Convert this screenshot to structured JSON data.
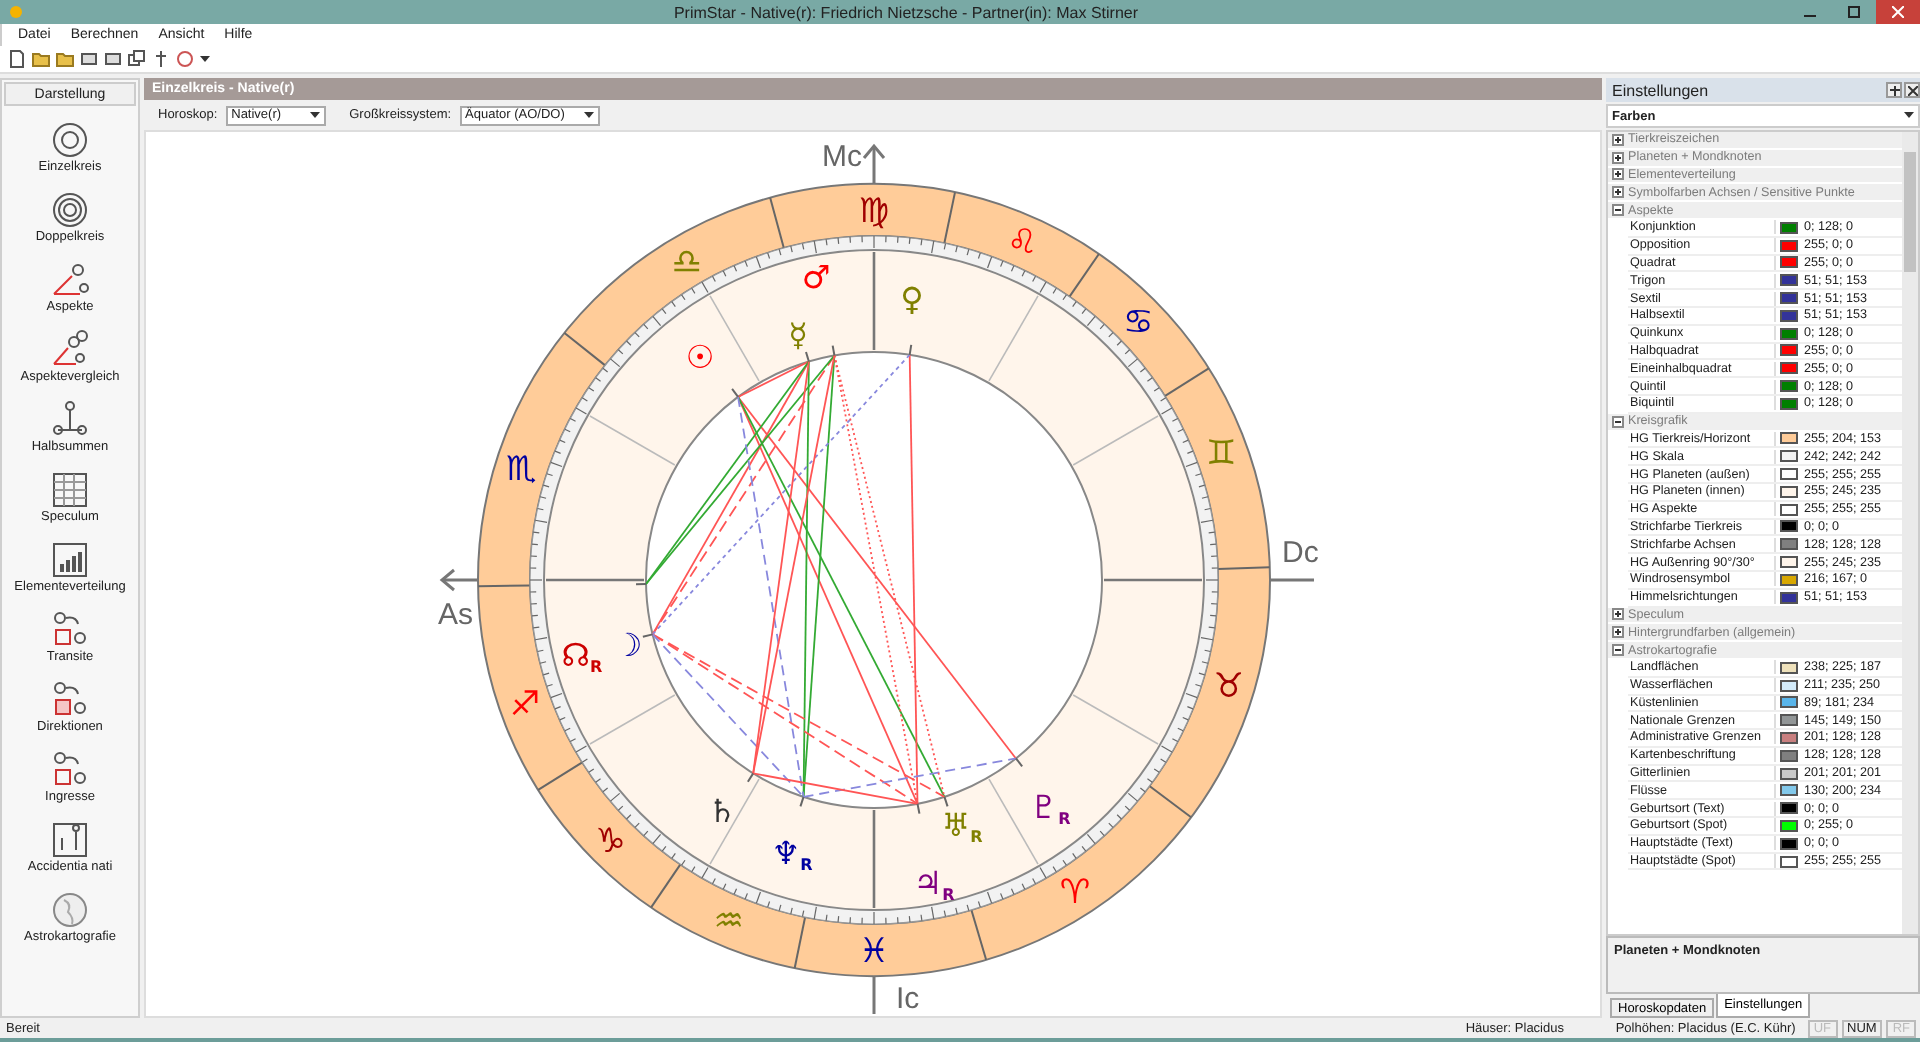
{
  "window": {
    "title": "PrimStar - Native(r): Friedrich Nietzsche - Partner(in): Max Stirner"
  },
  "menu": [
    "Datei",
    "Berechnen",
    "Ansicht",
    "Hilfe"
  ],
  "sidebar": {
    "title": "Darstellung",
    "items": [
      {
        "label": "Einzelkreis",
        "kind": "single"
      },
      {
        "label": "Doppelkreis",
        "kind": "double"
      },
      {
        "label": "Aspekte",
        "kind": "aspects"
      },
      {
        "label": "Aspektevergleich",
        "kind": "compare"
      },
      {
        "label": "Halbsummen",
        "kind": "midpoints"
      },
      {
        "label": "Speculum",
        "kind": "table"
      },
      {
        "label": "Elementeverteilung",
        "kind": "bars"
      },
      {
        "label": "Transite",
        "kind": "transit"
      },
      {
        "label": "Direktionen",
        "kind": "direction"
      },
      {
        "label": "Ingresse",
        "kind": "ingress"
      },
      {
        "label": "Accidentia nati",
        "kind": "accidentia"
      },
      {
        "label": "Astrokartografie",
        "kind": "globe"
      }
    ]
  },
  "view": {
    "title": "Einzelkreis - Native(r)",
    "horoscope": {
      "label": "Horoskop:",
      "value": "Native(r)"
    },
    "system": {
      "label": "Großkreissystem:",
      "value": "Äquator (AO/DO)"
    }
  },
  "chart": {
    "axes": [
      {
        "label": "Mc",
        "kind": "mc"
      },
      {
        "label": "As",
        "kind": "as"
      },
      {
        "label": "Dc",
        "kind": "dc"
      },
      {
        "label": "Ic",
        "kind": "ic"
      }
    ],
    "signs": [
      {
        "glyph": "♍",
        "color": "#a00000"
      },
      {
        "glyph": "♌",
        "color": "#ff0000"
      },
      {
        "glyph": "♋",
        "color": "#0000a0"
      },
      {
        "glyph": "♊",
        "color": "#808000"
      },
      {
        "glyph": "♉",
        "color": "#a00000"
      },
      {
        "glyph": "♈",
        "color": "#ff0000"
      },
      {
        "glyph": "♓",
        "color": "#0000a0"
      },
      {
        "glyph": "♒",
        "color": "#808000"
      },
      {
        "glyph": "♑",
        "color": "#a00000"
      },
      {
        "glyph": "♐",
        "color": "#ff0000"
      },
      {
        "glyph": "♏",
        "color": "#0000a0"
      },
      {
        "glyph": "♎",
        "color": "#808000"
      }
    ],
    "planets": [
      {
        "glyph": "♂",
        "color": "#ff0000"
      },
      {
        "glyph": "♀",
        "color": "#808000"
      },
      {
        "glyph": "☿",
        "color": "#808000"
      },
      {
        "glyph": "☉",
        "color": "#ff0000"
      },
      {
        "glyph": "☊",
        "color": "#cc0000",
        "suffix": "R"
      },
      {
        "glyph": "☽",
        "color": "#0000a0"
      },
      {
        "glyph": "♄",
        "color": "#333333"
      },
      {
        "glyph": "♆",
        "color": "#0000a0",
        "suffix": "R"
      },
      {
        "glyph": "♅",
        "color": "#808000",
        "suffix": "R"
      },
      {
        "glyph": "♇",
        "color": "#800080",
        "suffix": "R"
      },
      {
        "glyph": "♃",
        "color": "#800080",
        "suffix": "R"
      }
    ]
  },
  "settings": {
    "title": "Einstellungen",
    "dropdown": "Farben",
    "categories": [
      {
        "label": "Tierkreiszeichen",
        "expanded": false
      },
      {
        "label": "Planeten + Mondknoten",
        "expanded": false
      },
      {
        "label": "Elementeverteilung",
        "expanded": false
      },
      {
        "label": "Symbolfarben Achsen / Sensitive Punkte",
        "expanded": false
      },
      {
        "label": "Aspekte",
        "expanded": true,
        "items": [
          {
            "label": "Konjunktion",
            "color": "#008000",
            "value": "0; 128; 0"
          },
          {
            "label": "Opposition",
            "color": "#ff0000",
            "value": "255; 0; 0"
          },
          {
            "label": "Quadrat",
            "color": "#ff0000",
            "value": "255; 0; 0"
          },
          {
            "label": "Trigon",
            "color": "#333399",
            "value": "51; 51; 153"
          },
          {
            "label": "Sextil",
            "color": "#333399",
            "value": "51; 51; 153"
          },
          {
            "label": "Halbsextil",
            "color": "#333399",
            "value": "51; 51; 153"
          },
          {
            "label": "Quinkunx",
            "color": "#008000",
            "value": "0; 128; 0"
          },
          {
            "label": "Halbquadrat",
            "color": "#ff0000",
            "value": "255; 0; 0"
          },
          {
            "label": "Eineinhalbquadrat",
            "color": "#ff0000",
            "value": "255; 0; 0"
          },
          {
            "label": "Quintil",
            "color": "#008000",
            "value": "0; 128; 0"
          },
          {
            "label": "Biquintil",
            "color": "#008000",
            "value": "0; 128; 0"
          }
        ]
      },
      {
        "label": "Kreisgrafik",
        "expanded": true,
        "items": [
          {
            "label": "HG Tierkreis/Horizont",
            "color": "#ffcc99",
            "value": "255; 204; 153"
          },
          {
            "label": "HG Skala",
            "color": "#f2f2f2",
            "value": "242; 242; 242"
          },
          {
            "label": "HG Planeten (außen)",
            "color": "#ffffff",
            "value": "255; 255; 255"
          },
          {
            "label": "HG Planeten (innen)",
            "color": "#fff5eb",
            "value": "255; 245; 235"
          },
          {
            "label": "HG Aspekte",
            "color": "#ffffff",
            "value": "255; 255; 255"
          },
          {
            "label": "Strichfarbe Tierkreis",
            "color": "#000000",
            "value": "0; 0; 0"
          },
          {
            "label": "Strichfarbe Achsen",
            "color": "#808080",
            "value": "128; 128; 128"
          },
          {
            "label": "HG Außenring 90°/30°",
            "color": "#fff5eb",
            "value": "255; 245; 235"
          },
          {
            "label": "Windrosensymbol",
            "color": "#d8a700",
            "value": "216; 167; 0"
          },
          {
            "label": "Himmelsrichtungen",
            "color": "#333399",
            "value": "51; 51; 153"
          }
        ]
      },
      {
        "label": "Speculum",
        "expanded": false
      },
      {
        "label": "Hintergrundfarben (allgemein)",
        "expanded": false
      },
      {
        "label": "Astrokartografie",
        "expanded": true,
        "items": [
          {
            "label": "Landflächen",
            "color": "#eee1bb",
            "value": "238; 225; 187"
          },
          {
            "label": "Wasserflächen",
            "color": "#d3ebfa",
            "value": "211; 235; 250"
          },
          {
            "label": "Küstenlinien",
            "color": "#59b5ea",
            "value": "89; 181; 234"
          },
          {
            "label": "Nationale Grenzen",
            "color": "#919596",
            "value": "145; 149; 150"
          },
          {
            "label": "Administrative Grenzen",
            "color": "#c98080",
            "value": "201; 128; 128"
          },
          {
            "label": "Kartenbeschriftung",
            "color": "#808080",
            "value": "128; 128; 128"
          },
          {
            "label": "Gitterlinien",
            "color": "#c9c9c9",
            "value": "201; 201; 201"
          },
          {
            "label": "Flüsse",
            "color": "#82c8ea",
            "value": "130; 200; 234"
          },
          {
            "label": "Geburtsort (Text)",
            "color": "#000000",
            "value": "0; 0; 0"
          },
          {
            "label": "Geburtsort (Spot)",
            "color": "#00ff00",
            "value": "0; 255; 0"
          },
          {
            "label": "Hauptstädte (Text)",
            "color": "#000000",
            "value": "0; 0; 0"
          },
          {
            "label": "Hauptstädte (Spot)",
            "color": "#ffffff",
            "value": "255; 255; 255"
          }
        ]
      }
    ],
    "description": "Planeten + Mondknoten",
    "tabs": [
      {
        "label": "Horoskopdaten",
        "selected": false
      },
      {
        "label": "Einstellungen",
        "selected": true
      }
    ]
  },
  "status_bar": {
    "text": "Bereit",
    "houses": "Häuser: Placidus",
    "poles": "Polhöhen: Placidus (E.C. Kühr)",
    "indicators": [
      {
        "label": "UF",
        "on": false
      },
      {
        "label": "NUM",
        "on": true
      },
      {
        "label": "RF",
        "on": false
      }
    ]
  }
}
